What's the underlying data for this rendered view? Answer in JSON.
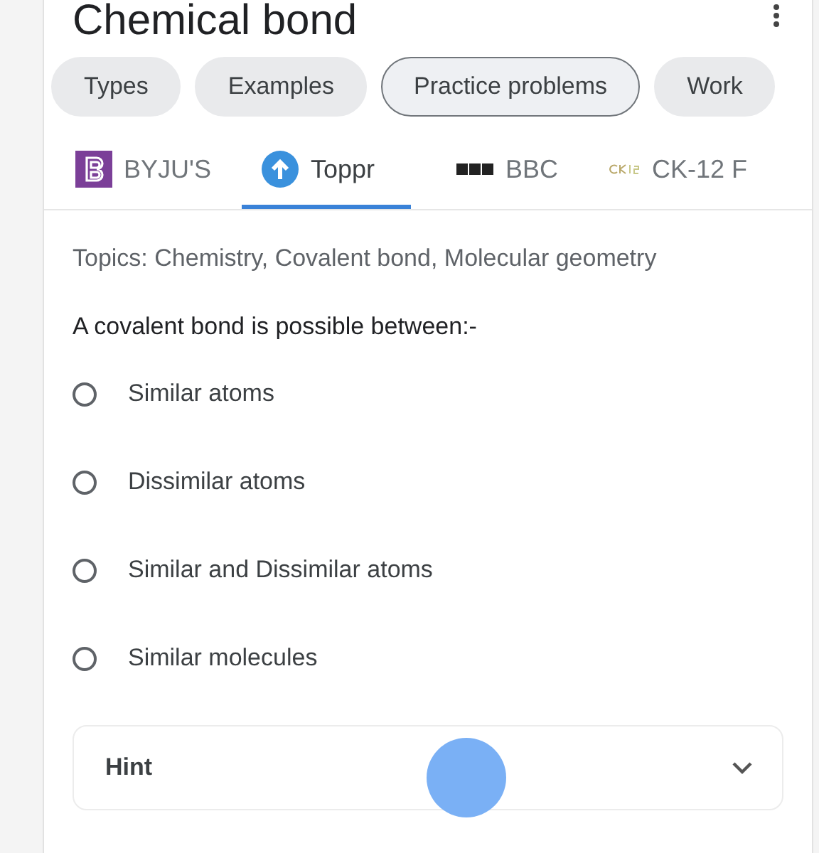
{
  "title": "Chemical bond",
  "chips": [
    {
      "label": "Types",
      "selected": false
    },
    {
      "label": "Examples",
      "selected": false
    },
    {
      "label": "Practice problems",
      "selected": true
    },
    {
      "label": "Work",
      "selected": false
    }
  ],
  "sources": [
    {
      "label": "BYJU'S",
      "kind": "byjus",
      "selected": false
    },
    {
      "label": "Toppr",
      "kind": "toppr",
      "selected": true
    },
    {
      "label": "BBC",
      "kind": "bbc",
      "selected": false
    },
    {
      "label": "CK-12 F",
      "kind": "ck12",
      "selected": false
    }
  ],
  "topics": "Topics: Chemistry, Covalent bond, Molecular geometry",
  "question": "A covalent bond is possible between:-",
  "options": [
    {
      "label": "Similar atoms",
      "selected": false
    },
    {
      "label": "Dissimilar atoms",
      "selected": false
    },
    {
      "label": "Similar and Dissimilar atoms",
      "selected": false
    },
    {
      "label": "Similar molecules",
      "selected": false
    }
  ],
  "hint": {
    "label": "Hint",
    "expanded": false
  }
}
